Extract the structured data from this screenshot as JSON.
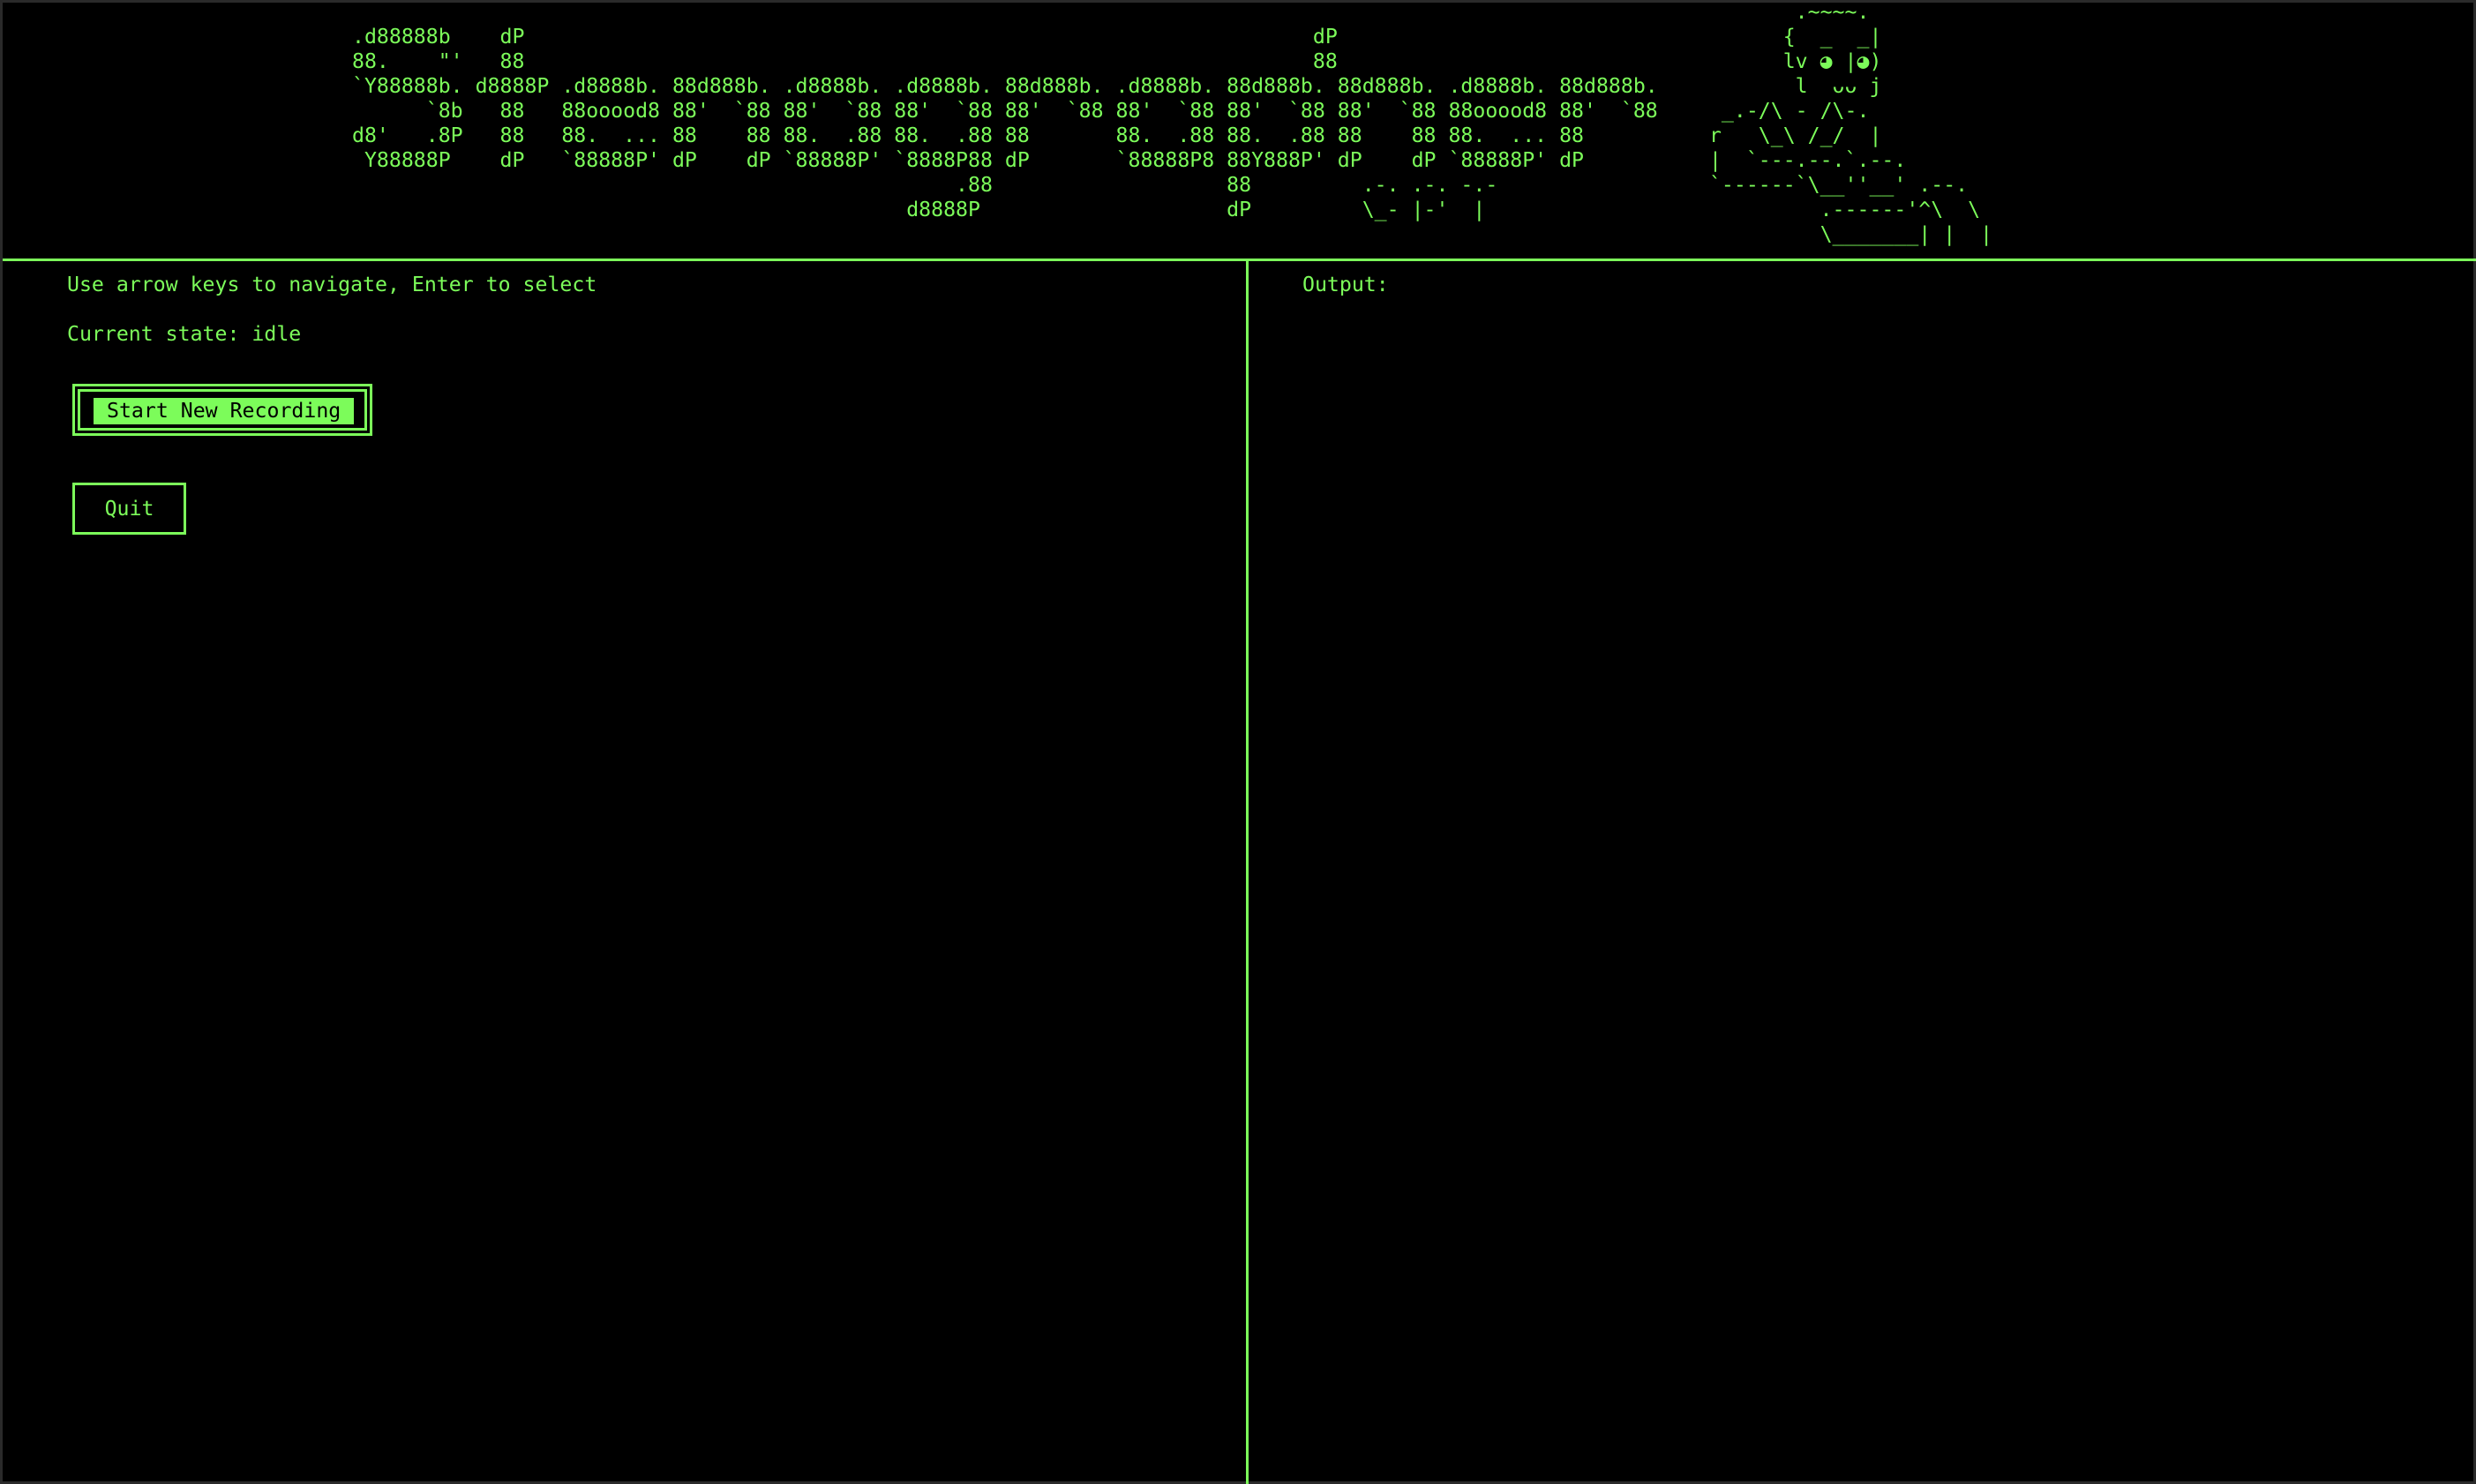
{
  "banner": {
    "logo_art": ".d88888b    dP                                                                dP\n88.    \"'   88                                                                88\n`Y88888b. d8888P .d8888b. 88d888b. .d8888b. .d8888b. 88d888b. .d8888b. 88d888b. 88d888b. .d8888b. 88d888b.\n      `8b   88   88ooood8 88'  `88 88'  `88 88'  `88 88'  `88 88'  `88 88'  `88 88'  `88 88ooood8 88'  `88\nd8'   .8P   88   88.  ... 88    88 88.  .88 88.  .88 88       88.  .88 88.  .88 88    88 88.  ... 88\n Y88888P    dP   `88888P' dP    dP `88888P' `8888P88 dP       `88888P8 88Y888P' dP    dP `88888P' dP\n                                                 .88                   88         .-. .-. -.-\n                                             d8888P                    dP         \\_- |-'  |",
    "mascot_art": "        .~~~~.\n       {  _  _|\n       lv ◕ |◕)\n        l  ᴗᴗ j\n  _.-/\\ - /\\-.\n r   \\_\\ /_/  |\n |  `---.--.`.--.\n `------`\\__''__' .--.\n          .------'^\\  \\\n          \\_______| |  |"
  },
  "left_panel": {
    "instructions": "Use arrow keys to navigate, Enter to select",
    "state_label": "Current state:",
    "state_value": "idle",
    "buttons": {
      "start": "Start New Recording",
      "quit": "Quit"
    }
  },
  "right_panel": {
    "output_label": "Output:"
  },
  "theme": {
    "foreground": "#7CFC5A",
    "background": "#000000"
  }
}
